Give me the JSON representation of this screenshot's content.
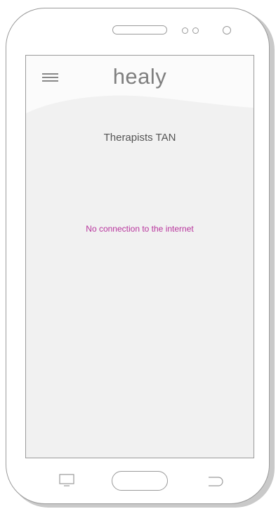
{
  "app": {
    "logo_text": "healy",
    "page_title": "Therapists TAN",
    "status_message": "No connection to the internet"
  },
  "colors": {
    "status_message": "#b8359d",
    "screen_background": "#f1f1f1",
    "header_background": "#fbfbfb",
    "logo": "#7f7f7f"
  },
  "icons": {
    "menu": "hamburger-menu-icon",
    "recent_apps": "recent-apps-icon",
    "home": "home-button",
    "back": "back-icon"
  }
}
